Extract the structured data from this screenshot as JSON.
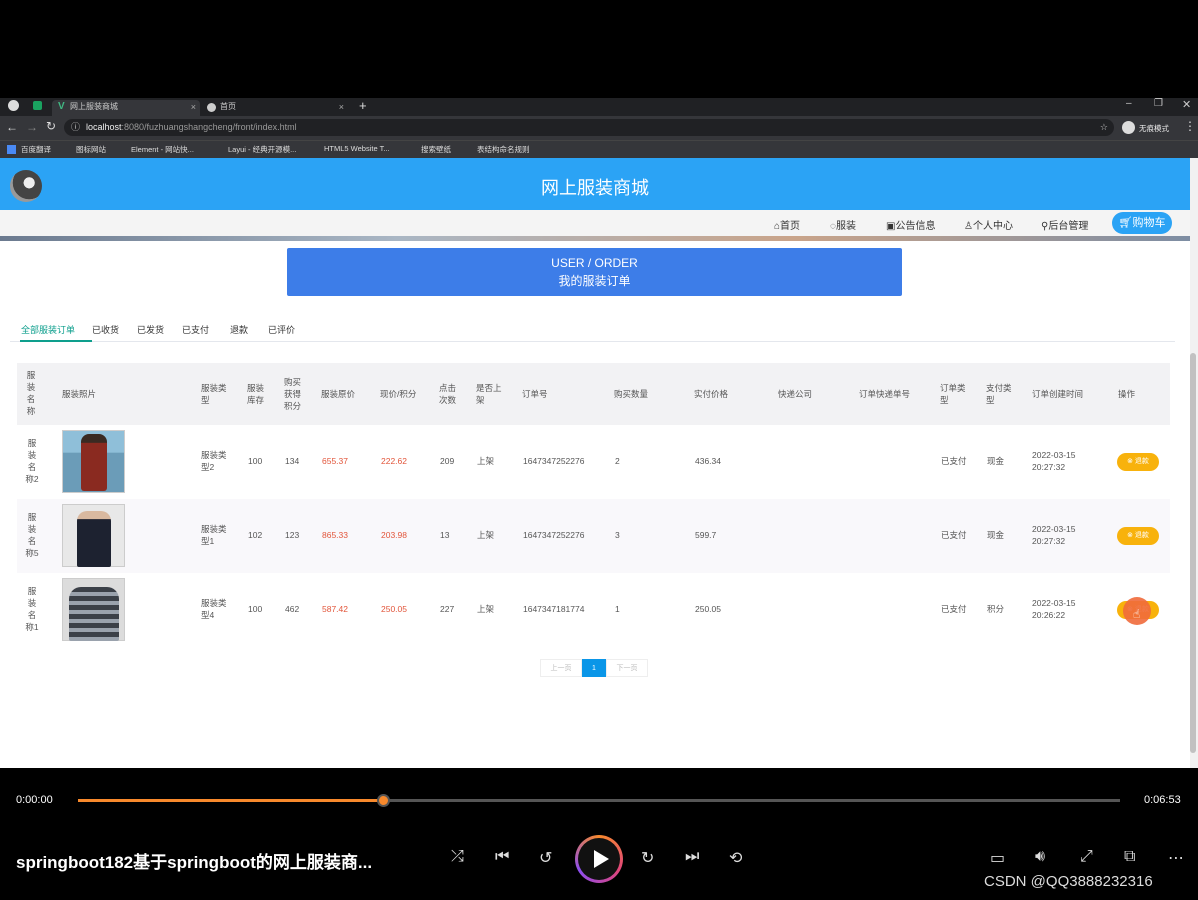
{
  "browser": {
    "tabs": [
      {
        "label": "网上服装商城",
        "close": "×"
      },
      {
        "label": "首页",
        "close": "×"
      }
    ],
    "new_tab": "+",
    "url_host": "localhost",
    "url_rest": ":8080/fuzhuangshangcheng/front/index.html",
    "profile": "无痕模式",
    "bookmarks": [
      "百度翻译",
      "图标网站",
      "Element - 网站快...",
      "Layui - 经典开源模...",
      "HTML5 Website T...",
      "搜索壁纸",
      "表结构命名规则"
    ]
  },
  "site": {
    "title": "网上服装商城",
    "nav": [
      "首页",
      "服装",
      "公告信息",
      "个人中心",
      "后台管理"
    ],
    "cart": "购物车"
  },
  "order_header": {
    "en": "USER / ORDER",
    "zh": "我的服装订单"
  },
  "order_tabs": [
    "全部服装订单",
    "已收货",
    "已发货",
    "已支付",
    "退款",
    "已评价"
  ],
  "active_tab": "全部服装订单",
  "table": {
    "headers": [
      "服装名称",
      "服装照片",
      "服装类型",
      "服装库存",
      "购买获得积分",
      "服装原价",
      "现价/积分",
      "点击次数",
      "是否上架",
      "订单号",
      "购买数量",
      "实付价格",
      "快递公司",
      "订单快递单号",
      "订单类型",
      "支付类型",
      "订单创建时间",
      "操作"
    ],
    "rows": [
      {
        "name": "服装名称2",
        "photo": "red-dress",
        "type": "服装类型2",
        "stock": "100",
        "points": "134",
        "orig": "655.37",
        "now": "222.62",
        "clicks": "209",
        "listed": "上架",
        "order_no": "1647347252276",
        "qty": "2",
        "paid": "436.34",
        "courier": "",
        "tracking": "",
        "order_type": "已支付",
        "pay_type": "现金",
        "date": "2022-03-15",
        "time": "20:27:32",
        "action": "退款"
      },
      {
        "name": "服装名称5",
        "photo": "dark-jacket",
        "type": "服装类型1",
        "stock": "102",
        "points": "123",
        "orig": "865.33",
        "now": "203.98",
        "clicks": "13",
        "listed": "上架",
        "order_no": "1647347252276",
        "qty": "3",
        "paid": "599.7",
        "courier": "",
        "tracking": "",
        "order_type": "已支付",
        "pay_type": "现金",
        "date": "2022-03-15",
        "time": "20:27:32",
        "action": "退款"
      },
      {
        "name": "服装名称1",
        "photo": "striped-polo",
        "type": "服装类型4",
        "stock": "100",
        "points": "462",
        "orig": "587.42",
        "now": "250.05",
        "clicks": "227",
        "listed": "上架",
        "order_no": "1647347181774",
        "qty": "1",
        "paid": "250.05",
        "courier": "",
        "tracking": "",
        "order_type": "已支付",
        "pay_type": "积分",
        "date": "2022-03-15",
        "time": "20:26:22",
        "action": "退款"
      }
    ]
  },
  "pager": {
    "prev": "上一页",
    "current": "1",
    "next": "下一页"
  },
  "player": {
    "elapsed": "0:00:00",
    "duration": "0:06:53",
    "progress_fraction": 0.294,
    "title": "springboot182基于springboot的网上服装商...",
    "watermark": "CSDN @QQ3888232316"
  },
  "colors": {
    "header_blue": "#2ba3f5",
    "order_blue": "#3d7de8",
    "accent_green": "#0e9f8d",
    "price_red": "#e2553a",
    "refund_orange": "#f8b20c",
    "progress_orange": "#f7892c"
  }
}
